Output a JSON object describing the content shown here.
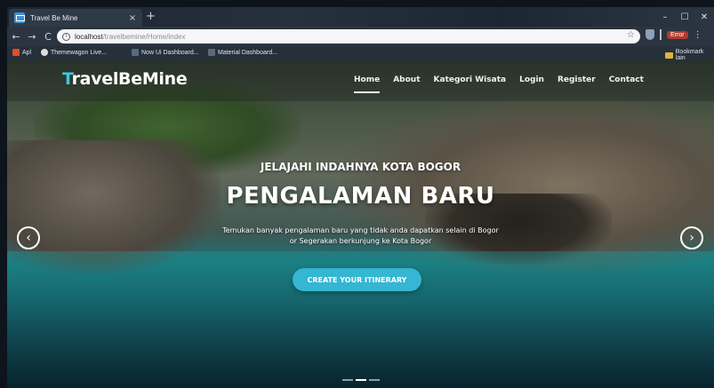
{
  "browser": {
    "tab_title": "Travel Be Mine",
    "tab_close": "×",
    "new_tab": "+",
    "window_controls": [
      "–",
      "☐",
      "✕"
    ],
    "url_host": "localhost",
    "url_path": "/travelbemine/Home/index",
    "error_label": "Error",
    "bookmarks": [
      "Apl",
      "Themewagon Live...",
      "Now Ui Dashboard...",
      "Material Dashboard...",
      "Bookmark lain"
    ]
  },
  "site": {
    "brand_initial": "T",
    "brand_rest": "ravelBeMine",
    "nav": [
      "Home",
      "About",
      "Kategori Wisata",
      "Login",
      "Register",
      "Contact"
    ],
    "hero_subtitle": "JELAJAHI INDAHNYA KOTA BOGOR",
    "hero_title": "PENGALAMAN BARU",
    "hero_desc_line1": "Temukan banyak pengalaman baru yang tidak anda dapatkan selain di Bogor",
    "hero_desc_line2": "or Segerakan berkunjung ke Kota Bogor",
    "cta_label": "CREATE YOUR ITINERARY",
    "slide_count": 3,
    "active_slide": 2
  },
  "icons": {
    "back": "←",
    "forward": "→",
    "reload": "C",
    "info": "i",
    "star": "☆",
    "menu": "⋮",
    "arrow_left": "‹",
    "arrow_right": "›"
  },
  "colors": {
    "brand_accent": "#3cc6e0",
    "cta": "#35b6d2",
    "error": "#b03a2e"
  }
}
